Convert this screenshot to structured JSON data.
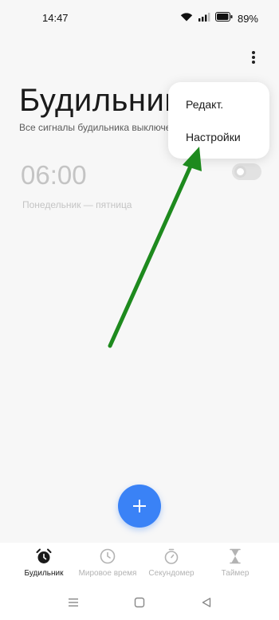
{
  "status_bar": {
    "time": "14:47",
    "battery_percent": "89%"
  },
  "header": {
    "title": "Будильник",
    "subtitle": "Все сигналы будильника выключены"
  },
  "alarm": {
    "time": "06:00",
    "days": "Понедельник — пятница",
    "enabled": false
  },
  "menu": {
    "items": [
      {
        "label": "Редакт."
      },
      {
        "label": "Настройки"
      }
    ]
  },
  "bottom_nav": {
    "tabs": [
      {
        "label": "Будильник",
        "icon": "alarm-clock-icon",
        "active": true
      },
      {
        "label": "Мировое время",
        "icon": "world-clock-icon",
        "active": false
      },
      {
        "label": "Секундомер",
        "icon": "stopwatch-icon",
        "active": false
      },
      {
        "label": "Таймер",
        "icon": "hourglass-icon",
        "active": false
      }
    ]
  },
  "colors": {
    "accent": "#3a82f6",
    "arrow": "#1e8a1e",
    "background": "#f7f7f7"
  }
}
